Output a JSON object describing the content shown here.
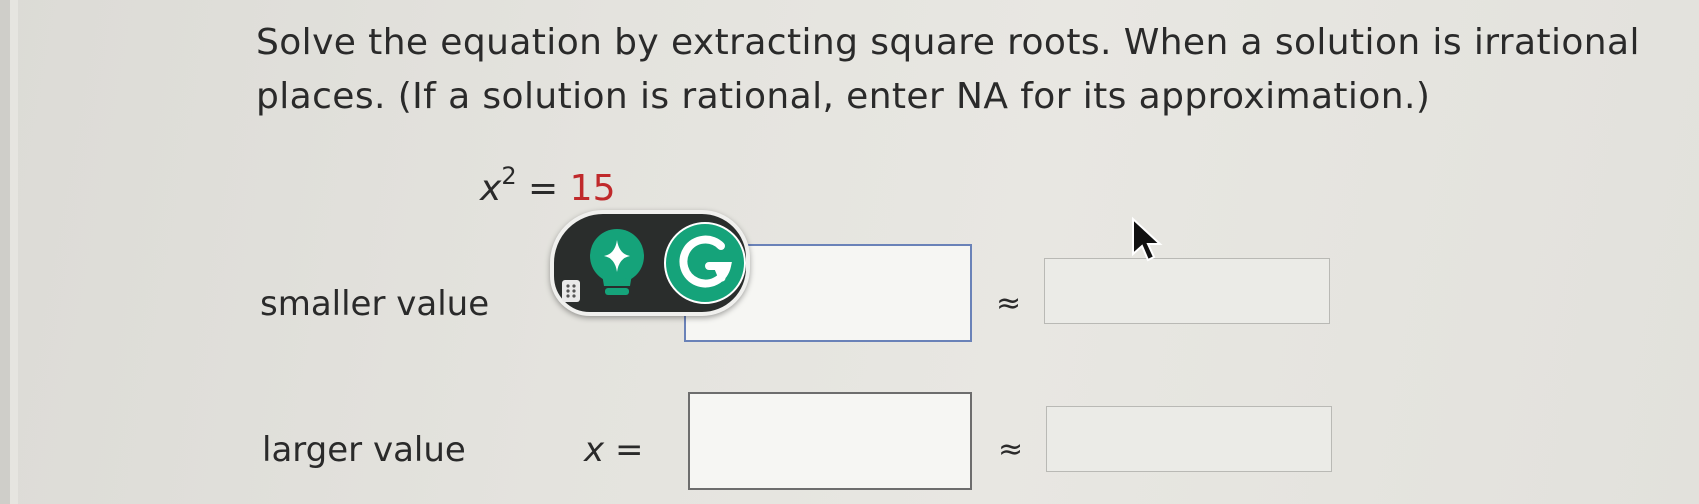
{
  "question": {
    "line1": "Solve the equation by extracting square roots. When a solution is irrational",
    "line2": "places. (If a solution is rational, enter NA for its approximation.)"
  },
  "equation": {
    "variable": "x",
    "exponent": "2",
    "equals": "=",
    "rhs": "15"
  },
  "answers": {
    "smaller_label": "smaller value",
    "larger_label": "larger value",
    "x_variable": "x",
    "x_equals": "=",
    "approx_symbol": "≈"
  },
  "icons": [
    "lightbulb-sparkle-icon",
    "grammarly-g-icon",
    "drag-handle-icon",
    "mouse-pointer-icon"
  ],
  "colors": {
    "rhs_red": "#c0292b",
    "grammarly_green": "#15a37a",
    "toolbar_bg": "#2a2d2c",
    "focused_border": "#6a82b8"
  }
}
